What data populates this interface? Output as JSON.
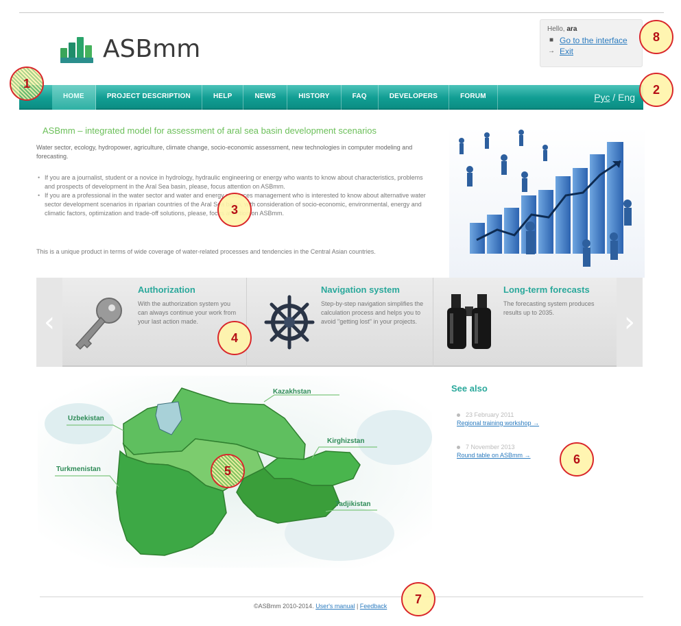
{
  "logo": {
    "text": "ASBmm"
  },
  "userbox": {
    "hello_prefix": "Hello, ",
    "username": "ara",
    "interface_link": "Go to the interface",
    "exit_link": "Exit"
  },
  "nav": {
    "items": [
      {
        "label": "HOME"
      },
      {
        "label": "PROJECT DESCRIPTION"
      },
      {
        "label": "HELP"
      },
      {
        "label": "NEWS"
      },
      {
        "label": "HISTORY"
      },
      {
        "label": "FAQ"
      },
      {
        "label": "DEVELOPERS"
      },
      {
        "label": "FORUM"
      }
    ],
    "lang_ru": "Рус",
    "lang_sep": " / ",
    "lang_en": "Eng"
  },
  "intro": {
    "title": "ASBmm – integrated model for assessment of aral sea basin development scenarios",
    "lead": "Water sector, ecology, hydropower, agriculture, climate change, socio-economic assessment, new technologies in computer modeling and forecasting.",
    "bullets": [
      "If you are a journalist, student or a novice in hydrology, hydraulic engineering or energy who wants to know about characteristics, problems and prospects of development in the Aral Sea basin, please, focus attention on ASBmm.",
      "If you are a professional in the water sector and water and energy resources management who is interested to know about alternative water sector development scenarios in riparian countries of the Aral Sea basin, with consideration of socio-economic, environmental, energy and climatic factors, optimization and trade-off solutions, please, focus attention on ASBmm."
    ],
    "tail": "This is a unique product in terms of wide coverage of water-related processes and tendencies in the Central Asian countries."
  },
  "features": [
    {
      "title": "Authorization",
      "text": "With the authorization system you can always continue your work from your last action made.",
      "icon": "key-icon"
    },
    {
      "title": "Navigation system",
      "text": "Step-by-step navigation simplifies the calculation process and helps you to avoid \"getting lost\" in your projects.",
      "icon": "ship-wheel-icon"
    },
    {
      "title": "Long-term forecasts",
      "text": "The forecasting system produces results up to 2035.",
      "icon": "binoculars-icon"
    }
  ],
  "map": {
    "labels": {
      "kazakhstan": "Kazakhstan",
      "uzbekistan": "Uzbekistan",
      "kirghizstan": "Kirghizstan",
      "turkmenistan": "Turkmenistan",
      "tadjikistan": "Tadjikistan"
    }
  },
  "see_also": {
    "title": "See also",
    "items": [
      {
        "date": "23 February 2011",
        "link": "Regional training workshop →"
      },
      {
        "date": "7 November 2013",
        "link": "Round table on ASBmm →"
      }
    ]
  },
  "footer": {
    "copyright": "©ASBmm 2010-2014. ",
    "manual": "User's manual",
    "sep": " | ",
    "feedback": "Feedback"
  },
  "callouts": [
    "1",
    "2",
    "3",
    "4",
    "5",
    "6",
    "7",
    "8"
  ],
  "colors": {
    "nav_teal": "#119e93",
    "accent_green": "#6bbf59",
    "heading_teal": "#2aa89b",
    "link_blue": "#2b7bbf",
    "callout_red": "#d9262b",
    "callout_fill": "#fff4aa",
    "map_green": "#4fb44f"
  }
}
